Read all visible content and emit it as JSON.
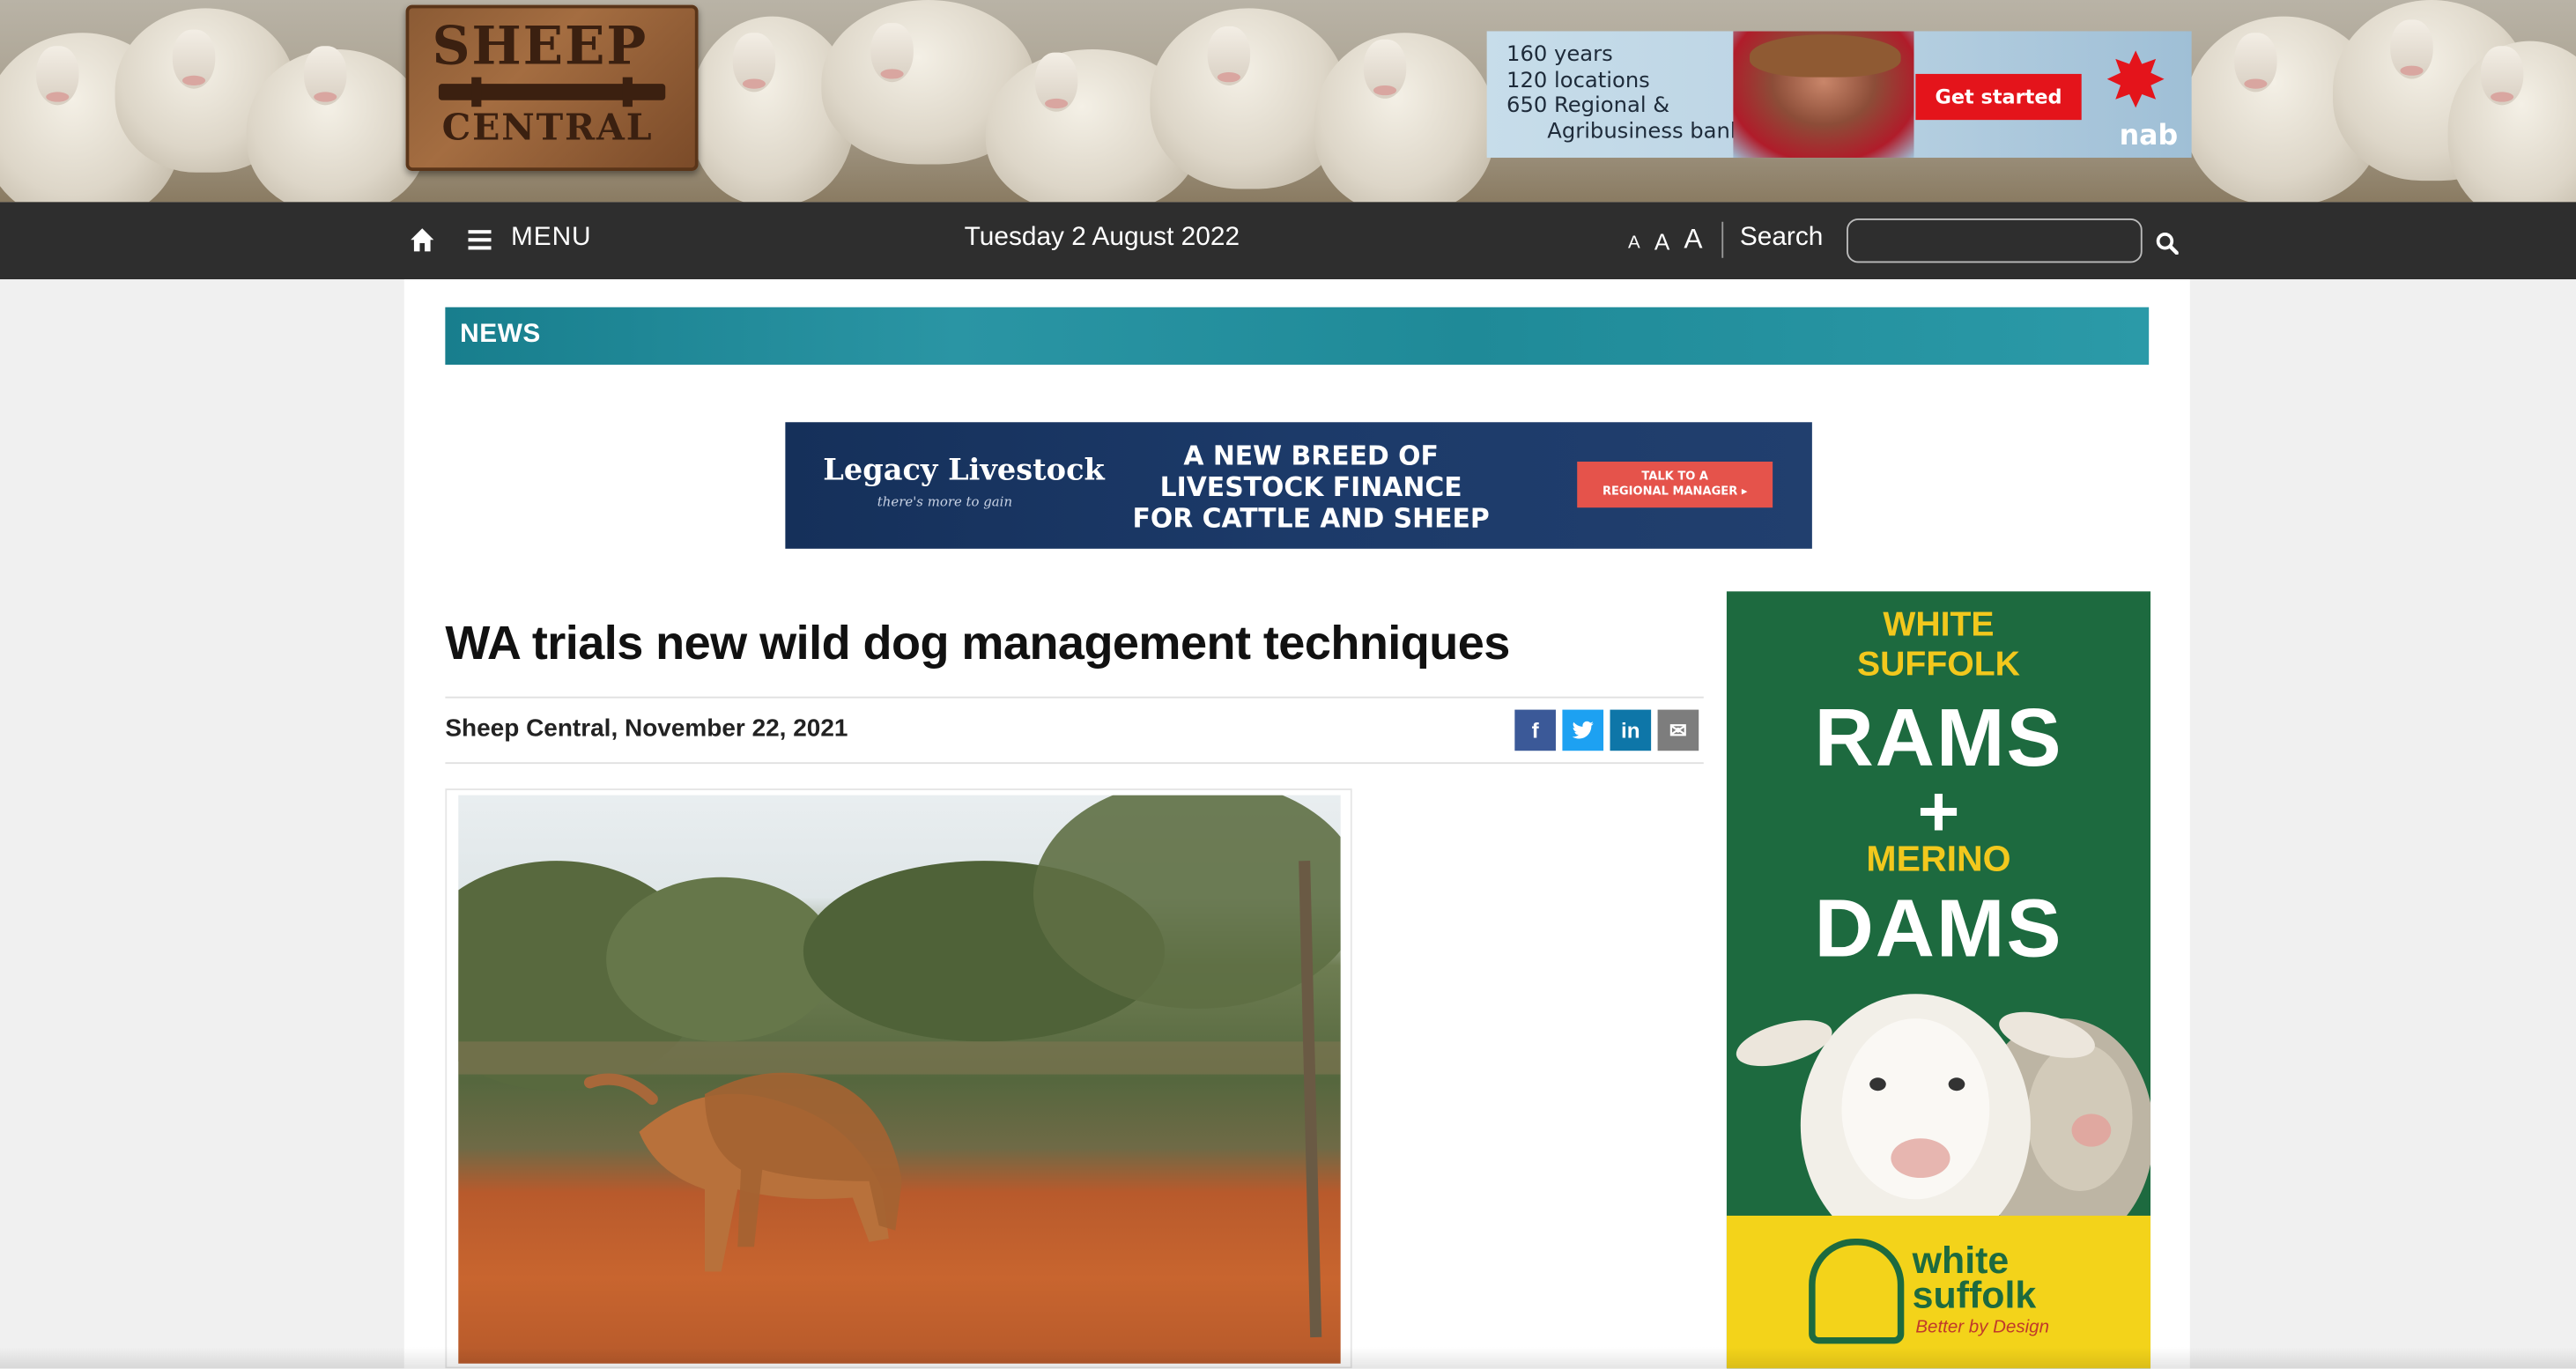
{
  "site": {
    "logo_line1": "SHEEP",
    "logo_line2": "CENTRAL"
  },
  "header_ad": {
    "lines": "160 years\n120 locations\n650 Regional &\n      Agribusiness bankers",
    "button": "Get started",
    "brand": "nab",
    "accent_color": "#e4141b"
  },
  "nav": {
    "home_icon": "home-icon",
    "menu_icon": "menu-icon",
    "menu_label": "MENU",
    "date": "Tuesday 2 August 2022",
    "font_sizes": [
      "A",
      "A",
      "A"
    ],
    "search_label": "Search",
    "search_value": "",
    "search_icon": "search-icon"
  },
  "section": {
    "label": "NEWS",
    "color": "#1f8a98"
  },
  "mid_ad": {
    "brand": "Legacy Livestock",
    "tagline": "there's more to gain",
    "headline_1": "A NEW BREED OF",
    "headline_2": "LIVESTOCK FINANCE",
    "headline_3": "FOR CATTLE AND SHEEP",
    "button_1": "TALK TO A",
    "button_2": "REGIONAL MANAGER",
    "button_arrow": "▸"
  },
  "article": {
    "title": "WA trials new wild dog management techniques",
    "byline": "Sheep Central, November 22, 2021",
    "share": [
      {
        "icon": "facebook-icon",
        "glyph": "f",
        "color": "#3b5998"
      },
      {
        "icon": "twitter-icon",
        "glyph": "t",
        "color": "#1da1f2"
      },
      {
        "icon": "linkedin-icon",
        "glyph": "in",
        "color": "#0e76a8"
      },
      {
        "icon": "email-icon",
        "glyph": "✉",
        "color": "#7d7d7d"
      }
    ]
  },
  "side_ad": {
    "line1": "WHITE",
    "line2": "SUFFOLK",
    "rams": "RAMS",
    "plus": "+",
    "merino": "MERINO",
    "dams": "DAMS",
    "logo_word_1": "white",
    "logo_word_2": "suffolk",
    "logo_tag": "Better by Design",
    "green": "#1d6a3f",
    "yellow": "#f3d31a"
  }
}
